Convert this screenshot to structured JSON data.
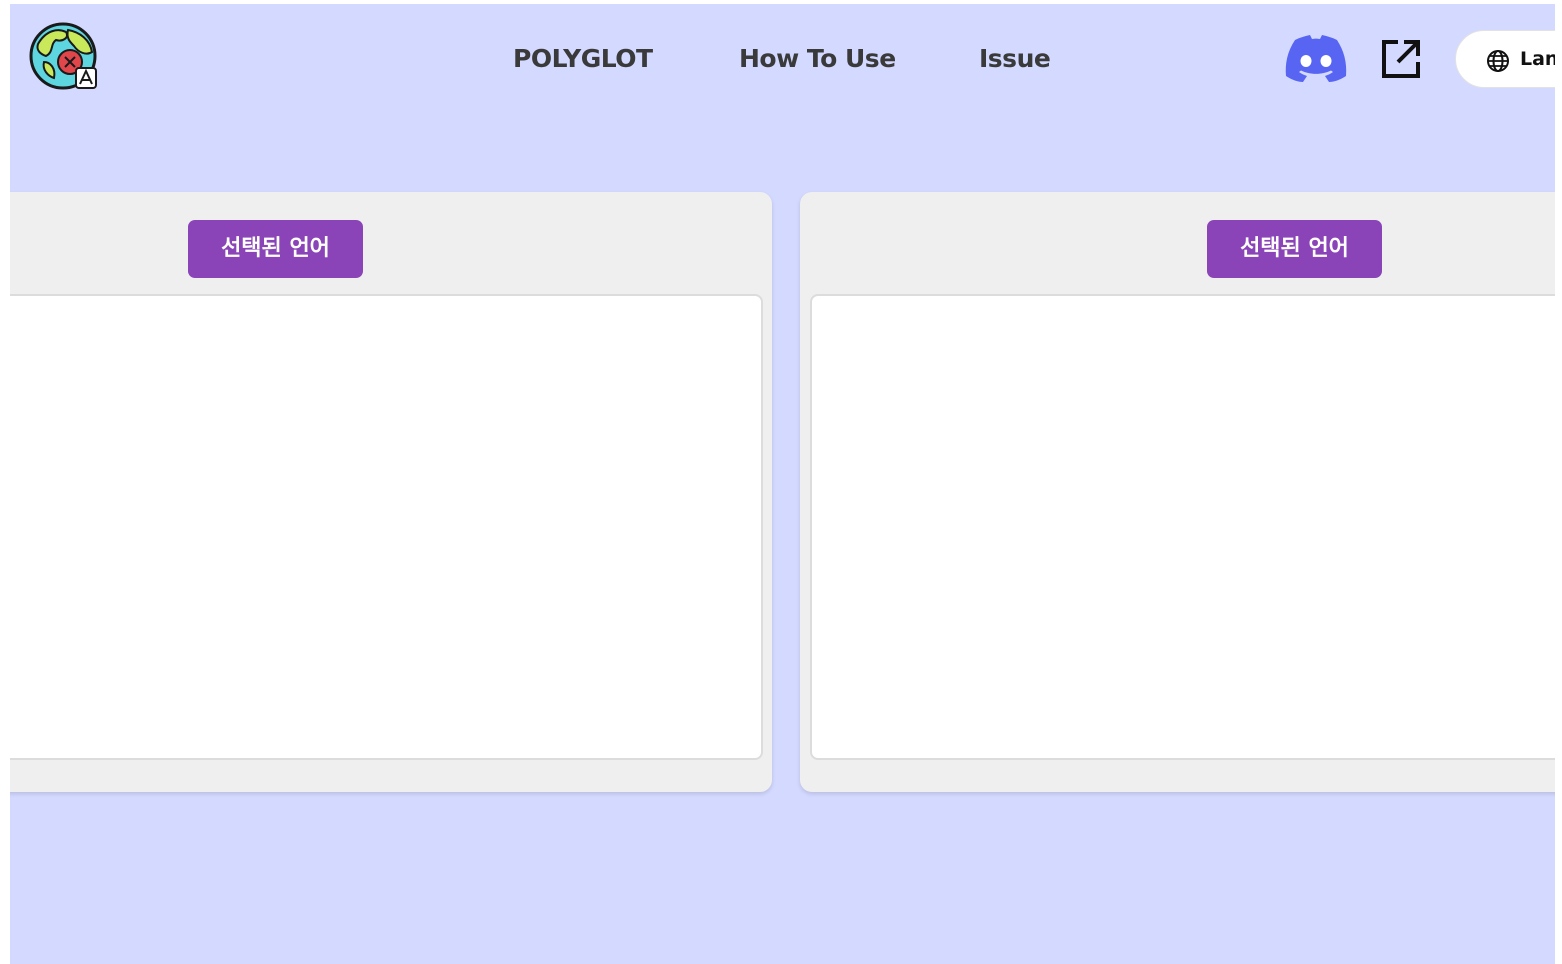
{
  "header": {
    "logo_icon": "globe-translate-logo-icon",
    "nav": [
      {
        "label": "POLYGLOT"
      },
      {
        "label": "How To Use"
      },
      {
        "label": "Issue"
      }
    ],
    "discord_icon": "discord-icon",
    "external_icon": "external-link-icon",
    "language_button": {
      "icon": "globe-icon",
      "label": "Lang"
    }
  },
  "source_panel": {
    "language_label": "선택된 언어",
    "text_value": ""
  },
  "target_panel": {
    "language_label": "선택된 언어",
    "text_value": ""
  },
  "colors": {
    "background": "#d3d9ff",
    "panel": "#efefef",
    "accent": "#8a44b7",
    "discord": "#5865f2"
  }
}
